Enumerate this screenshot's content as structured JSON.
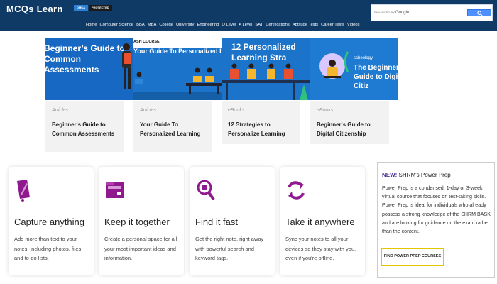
{
  "header": {
    "logo": "MCQs Learn",
    "badge_dmca": "DMCA",
    "badge_protected": "PROTECTED",
    "search_label": "ENHANCED BY",
    "search_brand": "Google",
    "nav": [
      "Home",
      "Computer Science",
      "BBA",
      "MBA",
      "College",
      "University",
      "Engineering",
      "O Level",
      "A Level",
      "SAT",
      "Certifications",
      "Aptitude Tests",
      "Career Tests",
      "Videos"
    ]
  },
  "banner": {
    "panel1_title": "Beginner’s Guide to Common Assessments",
    "panel2_caption": "ASH COURSE:",
    "panel2_title": "Your Guide To Personalized Le",
    "panel3_title": "12 Personalized Learning Stra",
    "panel4_brand": "schoology",
    "panel4_title": "The Beginner’s Guide to Digital Citiz",
    "brand": "schoology"
  },
  "cards": [
    {
      "category": "Articles",
      "title": "Beginner's Guide to Common Assessments"
    },
    {
      "category": "Articles",
      "title": "Your Guide To Personalized Learning"
    },
    {
      "category": "eBooks",
      "title": "12 Strategies to Personalize Learning"
    },
    {
      "category": "eBooks",
      "title": "Beginner's Guide to Digital Citizenship"
    }
  ],
  "features": [
    {
      "icon": "pen-note-icon",
      "title": "Capture anything",
      "text": "Add more than text to your notes, including photos, files and to-do lists."
    },
    {
      "icon": "folder-icon",
      "title": "Keep it together",
      "text": "Create a personal space for all your most important ideas and information."
    },
    {
      "icon": "magnifier-icon",
      "title": "Find it fast",
      "text": "Get the right note, right away with powerful search and keyword tags."
    },
    {
      "icon": "sync-icon",
      "title": "Take it anywhere",
      "text": "Sync your notes to all your devices so they stay with you, even if you're offline."
    }
  ],
  "promo": {
    "new_label": "NEW!",
    "title": " SHRM's Power Prep",
    "body": "Power Prep is a condensed, 1-day or 3-week virtual course that focuses on test-taking skills. Power Prep is ideal for individuals who already possess a strong knowledge of the SHRM BASK and are looking for guidance on the exam rather than the content.",
    "button": "FIND POWER PREP COURSES"
  },
  "colors": {
    "header": "#0f3a66",
    "accent_purple": "#8e1a8e",
    "banner_blue": "#1b74c9",
    "promo_button_border": "#e0c700"
  }
}
